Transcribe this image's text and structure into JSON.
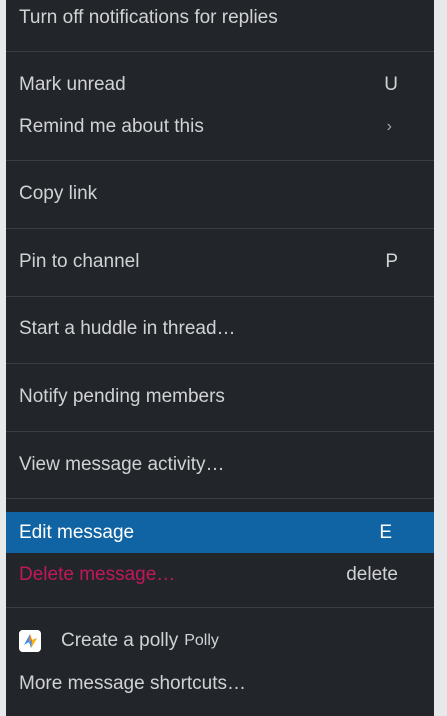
{
  "menu": {
    "items": [
      {
        "label": "Turn off notifications for replies",
        "shortcut": ""
      },
      {
        "label": "Mark unread",
        "shortcut": "U"
      },
      {
        "label": "Remind me about this",
        "shortcut": "›"
      },
      {
        "label": "Copy link",
        "shortcut": ""
      },
      {
        "label": "Pin to channel",
        "shortcut": "P"
      },
      {
        "label": "Start a huddle in thread…",
        "shortcut": ""
      },
      {
        "label": "Notify pending members",
        "shortcut": ""
      },
      {
        "label": "View message activity…",
        "shortcut": ""
      },
      {
        "label": "Edit message",
        "shortcut": "E"
      },
      {
        "label": "Delete message…",
        "shortcut": "delete"
      },
      {
        "label": "Create a polly",
        "app": "Polly",
        "icon": "polly-app-icon"
      },
      {
        "label": "More message shortcuts…",
        "shortcut": ""
      }
    ]
  },
  "colors": {
    "menu_bg": "#222529",
    "highlight": "#1164a3",
    "danger": "#c2185b"
  }
}
